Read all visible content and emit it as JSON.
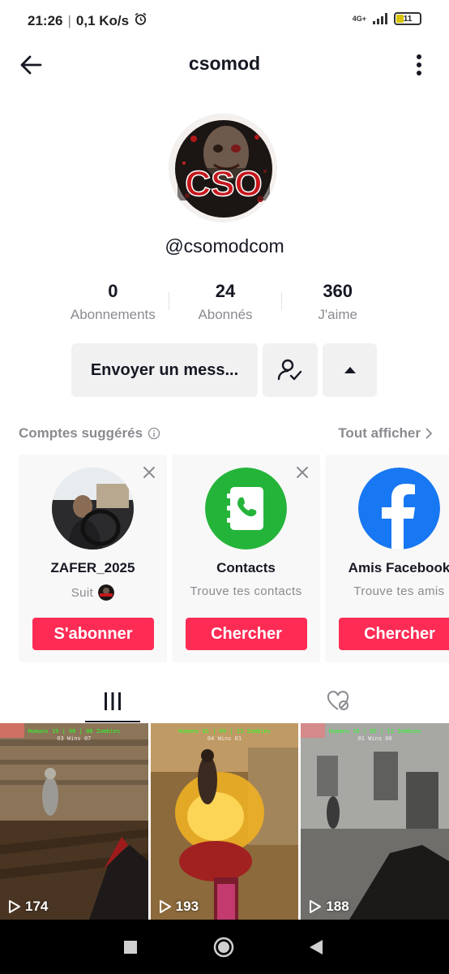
{
  "status_bar": {
    "time": "21:26",
    "speed": "0,1 Ko/s",
    "network": "4G+",
    "battery": "11"
  },
  "header": {
    "title": "csomod"
  },
  "profile": {
    "handle": "@csomodcom",
    "avatar_text": "CSO",
    "stats": [
      {
        "value": "0",
        "label": "Abonnements"
      },
      {
        "value": "24",
        "label": "Abonnés"
      },
      {
        "value": "360",
        "label": "J'aime"
      }
    ],
    "message_button": "Envoyer un mess..."
  },
  "suggested": {
    "title": "Comptes suggérés",
    "view_all": "Tout afficher",
    "cards": [
      {
        "name": "ZAFER_2025",
        "sub": "Suit",
        "button": "S'abonner"
      },
      {
        "name": "Contacts",
        "sub": "Trouve tes contacts",
        "button": "Chercher"
      },
      {
        "name": "Amis Facebook",
        "sub": "Trouve tes amis",
        "button": "Chercher"
      }
    ]
  },
  "videos": [
    {
      "views": "174",
      "hud_top": "Humans 19 | 08 | 08 Zombies",
      "hud_sub": "03 Wins 07"
    },
    {
      "views": "193",
      "hud_top": "Humans 01 | 09 | 13 Zombies",
      "hud_sub": "04 Wins 01"
    },
    {
      "views": "188",
      "hud_top": "Humans 16 | 05 | 11 Zombies",
      "hud_sub": "01 Wins 00"
    }
  ],
  "colors": {
    "accent": "#fe2c55",
    "text_primary": "#161823",
    "text_secondary": "#8a8b91",
    "contacts_green": "#25b43a",
    "facebook_blue": "#1877f2"
  }
}
